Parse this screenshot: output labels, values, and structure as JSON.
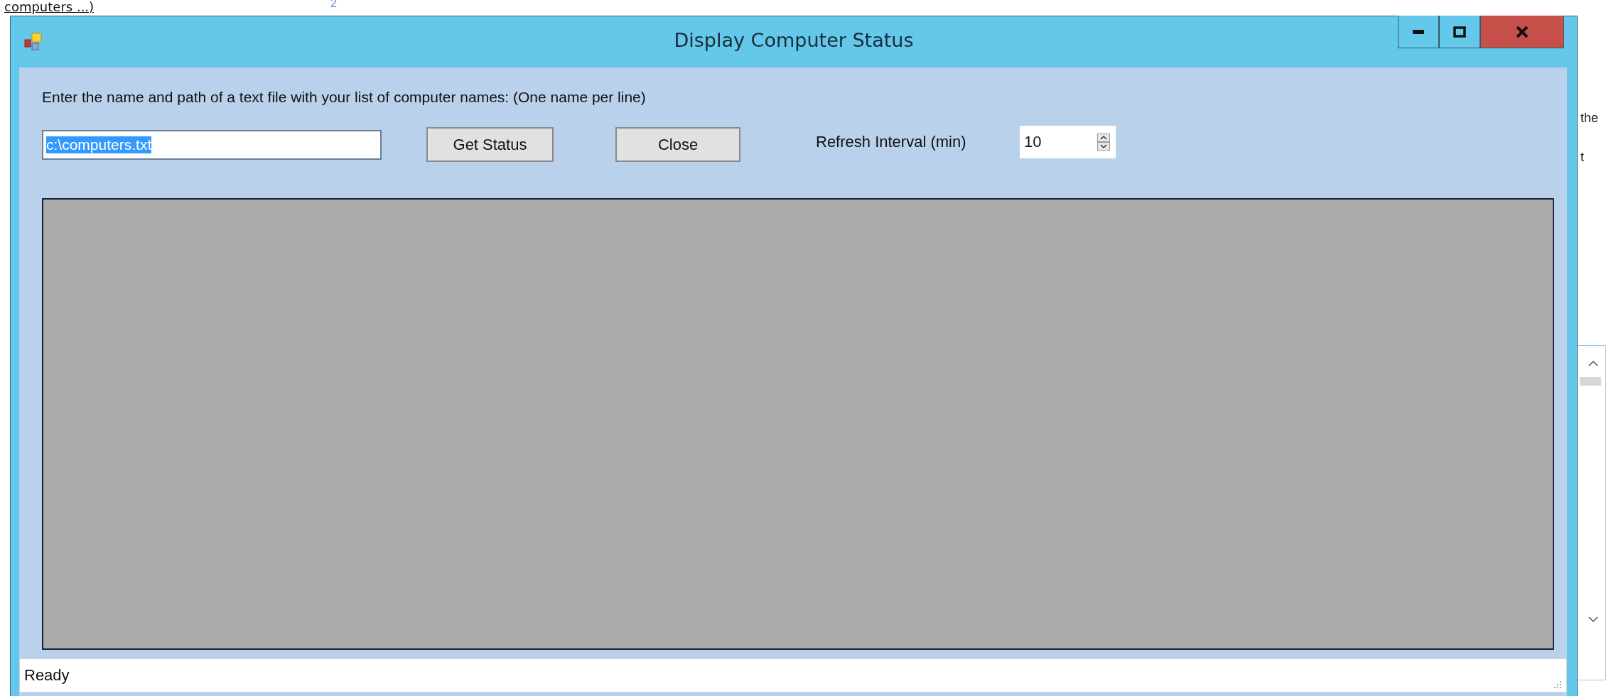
{
  "background": {
    "heading_fragment": "computers ...)",
    "line_number": "2",
    "side_texts": [
      "the",
      "t"
    ]
  },
  "window": {
    "title": "Display Computer Status"
  },
  "prompt": "Enter the name and path of a text file with your list of computer names: (One name per line)",
  "file_field": {
    "value": "c:\\computers.txt",
    "text_selected": true
  },
  "buttons": [
    {
      "label": "Get Status"
    },
    {
      "label": "Close"
    }
  ],
  "refresh": {
    "label": "Refresh Interval (min)",
    "value": "10"
  },
  "status_bar": {
    "text": "Ready"
  }
}
